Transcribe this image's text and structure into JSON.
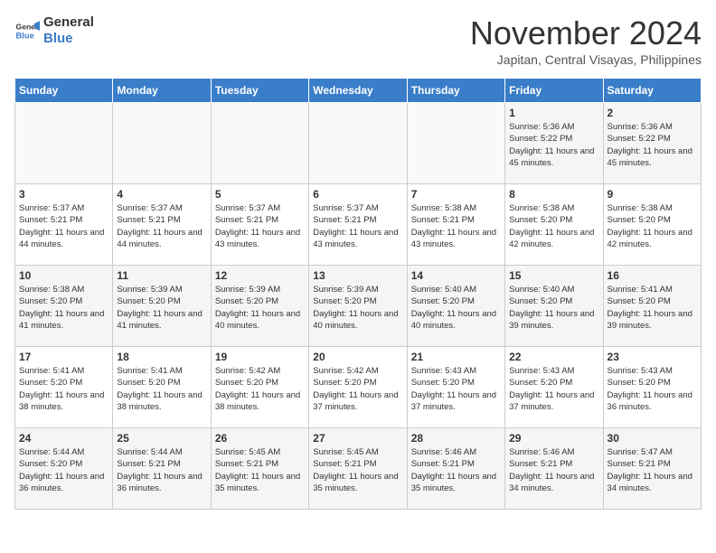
{
  "header": {
    "logo_line1": "General",
    "logo_line2": "Blue",
    "month": "November 2024",
    "location": "Japitan, Central Visayas, Philippines"
  },
  "weekdays": [
    "Sunday",
    "Monday",
    "Tuesday",
    "Wednesday",
    "Thursday",
    "Friday",
    "Saturday"
  ],
  "weeks": [
    [
      {
        "day": "",
        "info": ""
      },
      {
        "day": "",
        "info": ""
      },
      {
        "day": "",
        "info": ""
      },
      {
        "day": "",
        "info": ""
      },
      {
        "day": "",
        "info": ""
      },
      {
        "day": "1",
        "info": "Sunrise: 5:36 AM\nSunset: 5:22 PM\nDaylight: 11 hours and 45 minutes."
      },
      {
        "day": "2",
        "info": "Sunrise: 5:36 AM\nSunset: 5:22 PM\nDaylight: 11 hours and 45 minutes."
      }
    ],
    [
      {
        "day": "3",
        "info": "Sunrise: 5:37 AM\nSunset: 5:21 PM\nDaylight: 11 hours and 44 minutes."
      },
      {
        "day": "4",
        "info": "Sunrise: 5:37 AM\nSunset: 5:21 PM\nDaylight: 11 hours and 44 minutes."
      },
      {
        "day": "5",
        "info": "Sunrise: 5:37 AM\nSunset: 5:21 PM\nDaylight: 11 hours and 43 minutes."
      },
      {
        "day": "6",
        "info": "Sunrise: 5:37 AM\nSunset: 5:21 PM\nDaylight: 11 hours and 43 minutes."
      },
      {
        "day": "7",
        "info": "Sunrise: 5:38 AM\nSunset: 5:21 PM\nDaylight: 11 hours and 43 minutes."
      },
      {
        "day": "8",
        "info": "Sunrise: 5:38 AM\nSunset: 5:20 PM\nDaylight: 11 hours and 42 minutes."
      },
      {
        "day": "9",
        "info": "Sunrise: 5:38 AM\nSunset: 5:20 PM\nDaylight: 11 hours and 42 minutes."
      }
    ],
    [
      {
        "day": "10",
        "info": "Sunrise: 5:38 AM\nSunset: 5:20 PM\nDaylight: 11 hours and 41 minutes."
      },
      {
        "day": "11",
        "info": "Sunrise: 5:39 AM\nSunset: 5:20 PM\nDaylight: 11 hours and 41 minutes."
      },
      {
        "day": "12",
        "info": "Sunrise: 5:39 AM\nSunset: 5:20 PM\nDaylight: 11 hours and 40 minutes."
      },
      {
        "day": "13",
        "info": "Sunrise: 5:39 AM\nSunset: 5:20 PM\nDaylight: 11 hours and 40 minutes."
      },
      {
        "day": "14",
        "info": "Sunrise: 5:40 AM\nSunset: 5:20 PM\nDaylight: 11 hours and 40 minutes."
      },
      {
        "day": "15",
        "info": "Sunrise: 5:40 AM\nSunset: 5:20 PM\nDaylight: 11 hours and 39 minutes."
      },
      {
        "day": "16",
        "info": "Sunrise: 5:41 AM\nSunset: 5:20 PM\nDaylight: 11 hours and 39 minutes."
      }
    ],
    [
      {
        "day": "17",
        "info": "Sunrise: 5:41 AM\nSunset: 5:20 PM\nDaylight: 11 hours and 38 minutes."
      },
      {
        "day": "18",
        "info": "Sunrise: 5:41 AM\nSunset: 5:20 PM\nDaylight: 11 hours and 38 minutes."
      },
      {
        "day": "19",
        "info": "Sunrise: 5:42 AM\nSunset: 5:20 PM\nDaylight: 11 hours and 38 minutes."
      },
      {
        "day": "20",
        "info": "Sunrise: 5:42 AM\nSunset: 5:20 PM\nDaylight: 11 hours and 37 minutes."
      },
      {
        "day": "21",
        "info": "Sunrise: 5:43 AM\nSunset: 5:20 PM\nDaylight: 11 hours and 37 minutes."
      },
      {
        "day": "22",
        "info": "Sunrise: 5:43 AM\nSunset: 5:20 PM\nDaylight: 11 hours and 37 minutes."
      },
      {
        "day": "23",
        "info": "Sunrise: 5:43 AM\nSunset: 5:20 PM\nDaylight: 11 hours and 36 minutes."
      }
    ],
    [
      {
        "day": "24",
        "info": "Sunrise: 5:44 AM\nSunset: 5:20 PM\nDaylight: 11 hours and 36 minutes."
      },
      {
        "day": "25",
        "info": "Sunrise: 5:44 AM\nSunset: 5:21 PM\nDaylight: 11 hours and 36 minutes."
      },
      {
        "day": "26",
        "info": "Sunrise: 5:45 AM\nSunset: 5:21 PM\nDaylight: 11 hours and 35 minutes."
      },
      {
        "day": "27",
        "info": "Sunrise: 5:45 AM\nSunset: 5:21 PM\nDaylight: 11 hours and 35 minutes."
      },
      {
        "day": "28",
        "info": "Sunrise: 5:46 AM\nSunset: 5:21 PM\nDaylight: 11 hours and 35 minutes."
      },
      {
        "day": "29",
        "info": "Sunrise: 5:46 AM\nSunset: 5:21 PM\nDaylight: 11 hours and 34 minutes."
      },
      {
        "day": "30",
        "info": "Sunrise: 5:47 AM\nSunset: 5:21 PM\nDaylight: 11 hours and 34 minutes."
      }
    ]
  ]
}
